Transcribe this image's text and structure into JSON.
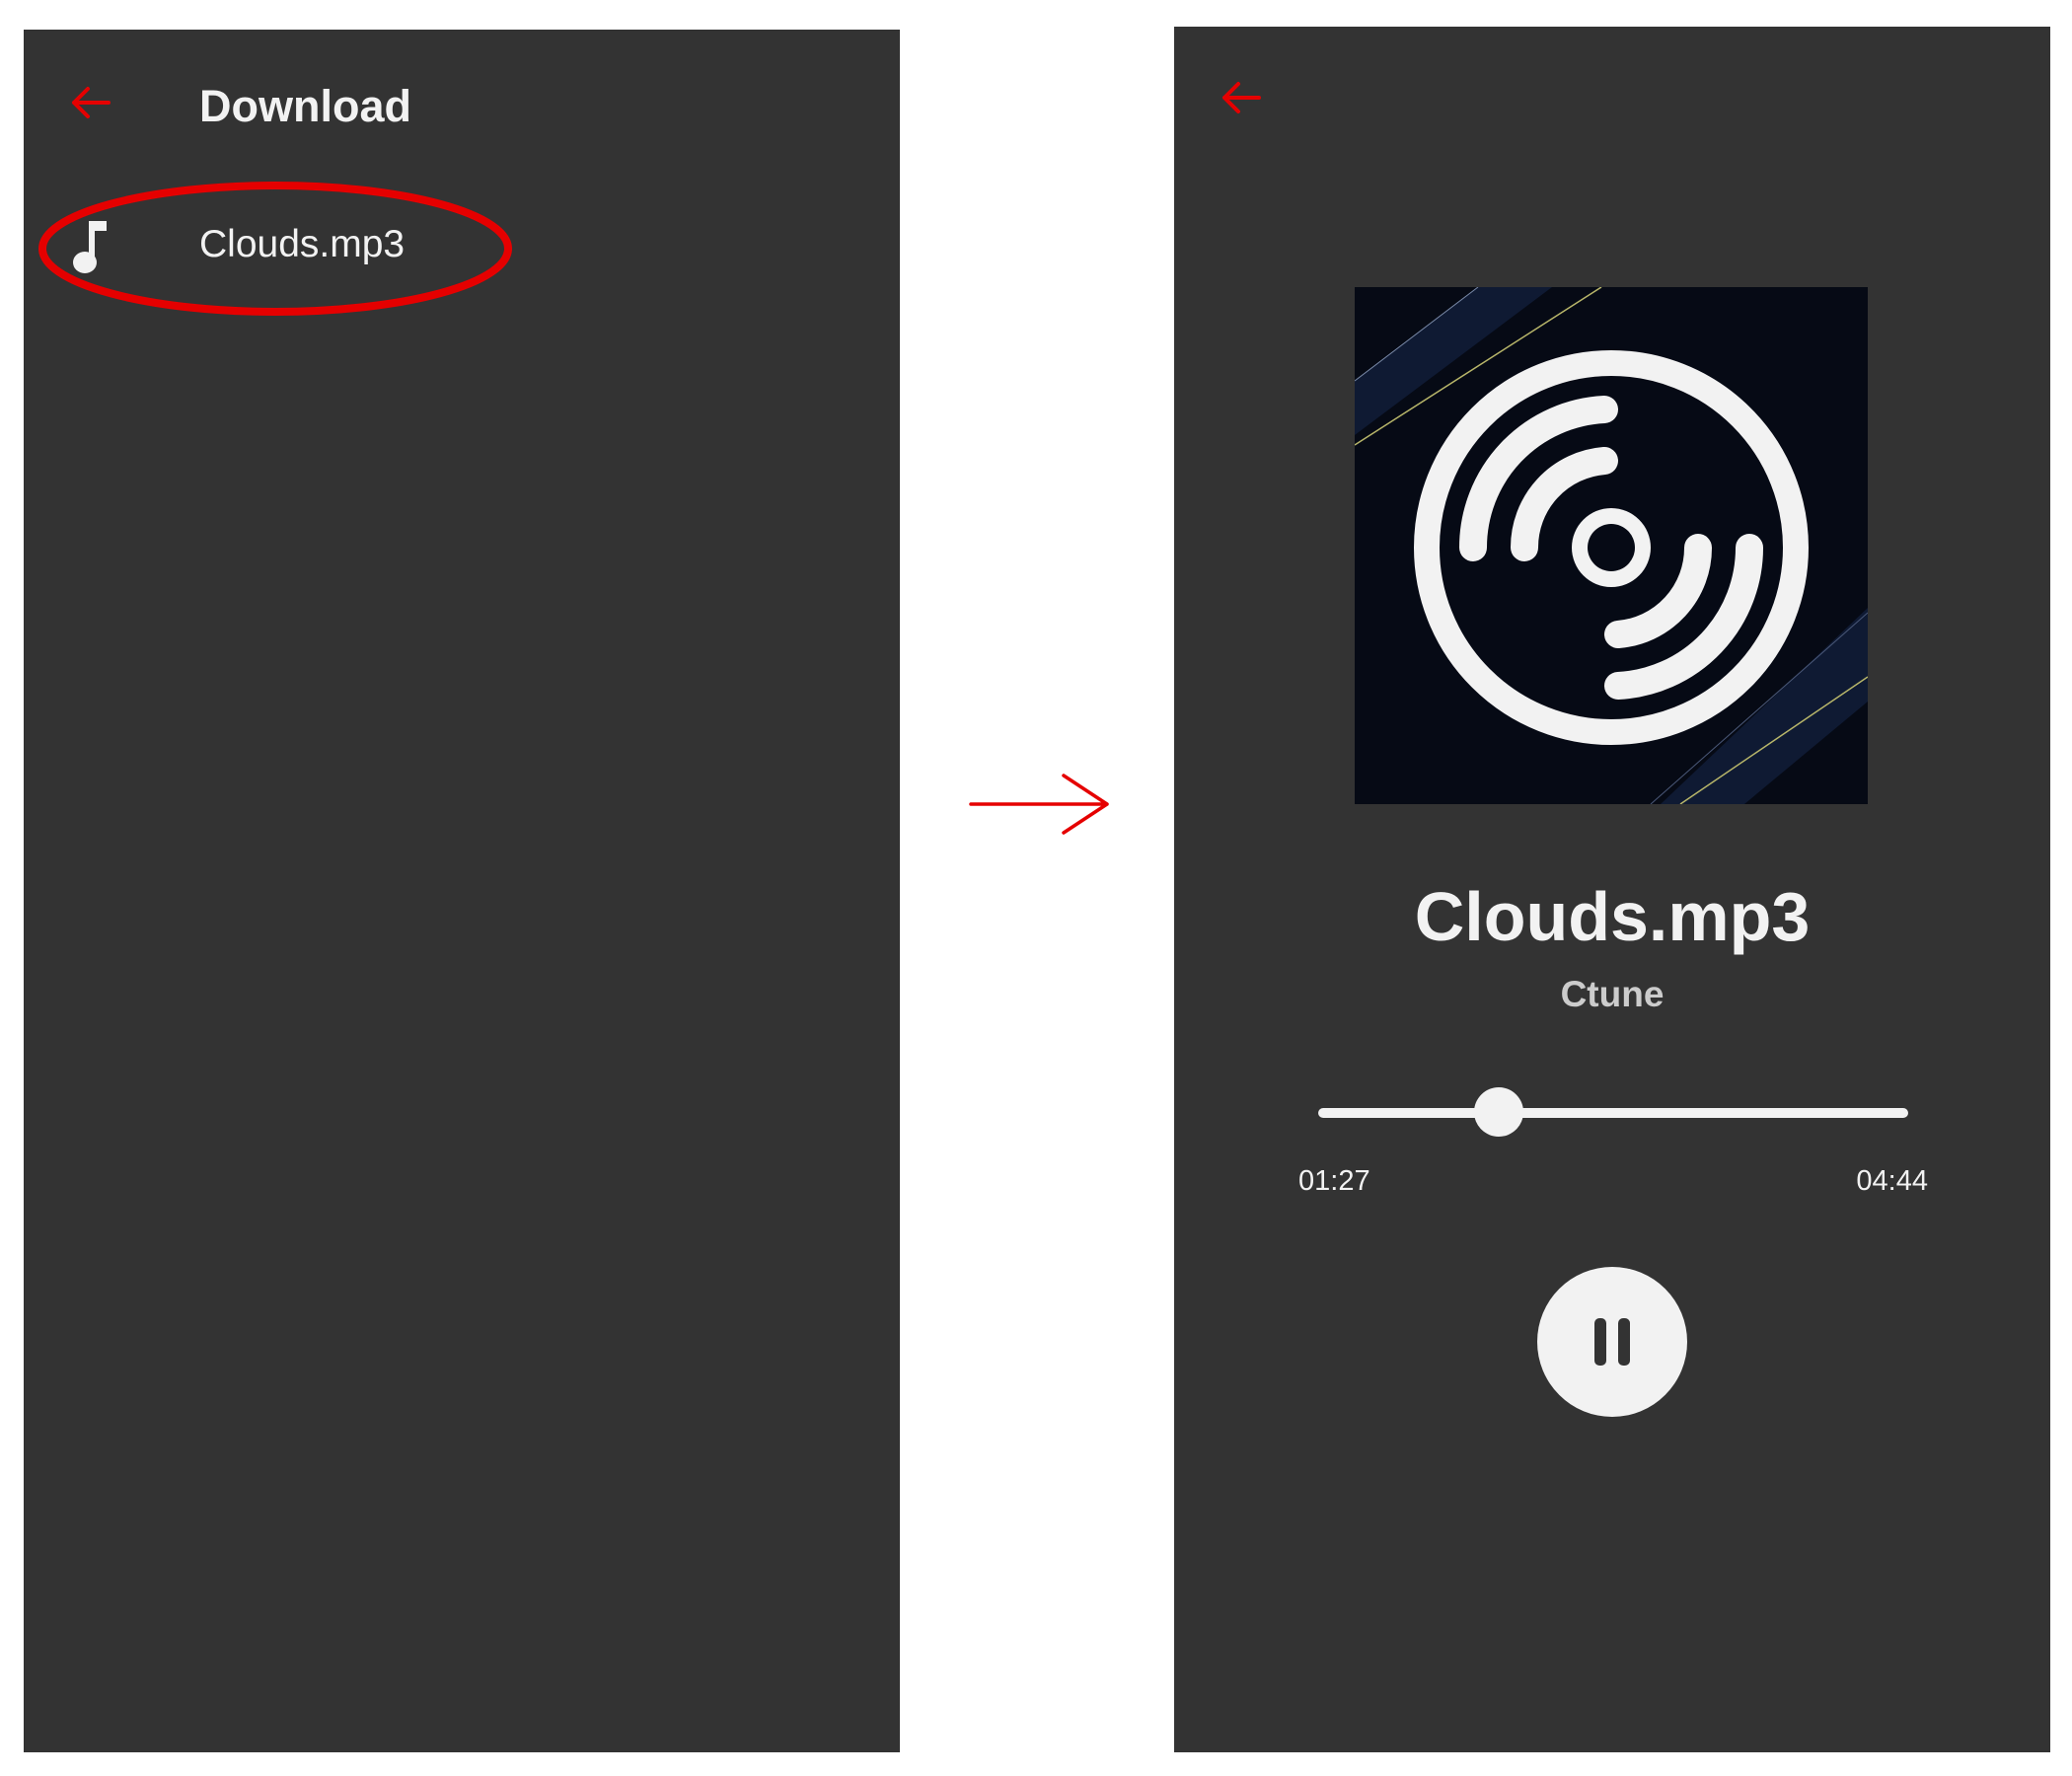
{
  "colors": {
    "screen_background": "#333333",
    "accent_red": "#e50000",
    "text_primary": "#f2f2f2",
    "text_secondary": "#cccccc"
  },
  "download_screen": {
    "back_icon": "arrow-left-icon",
    "title": "Download",
    "items": [
      {
        "icon": "music-note-icon",
        "label": "Clouds.mp3",
        "highlighted": true
      }
    ]
  },
  "flow_arrow_icon": "arrow-right-icon",
  "player_screen": {
    "back_icon": "arrow-left-icon",
    "album_art_icon": "vinyl-disc-icon",
    "track_title": "Clouds.mp3",
    "artist": "Ctune",
    "progress": {
      "elapsed": "01:27",
      "total": "04:44",
      "fraction": 0.306
    },
    "play_pause_icon": "pause-icon"
  }
}
